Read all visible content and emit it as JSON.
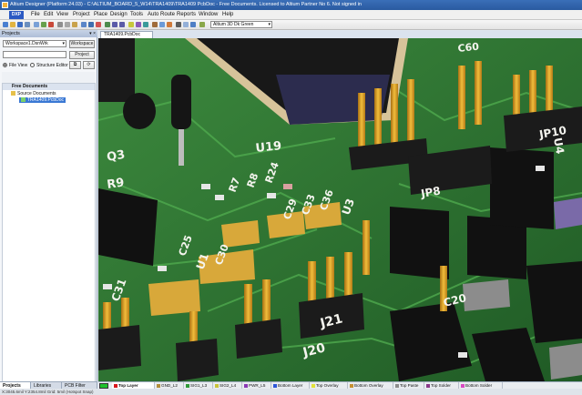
{
  "window": {
    "title": "Altium Designer (Platform 24.03) - C:\\ALTIUM_BOARD_5_W14\\TRA1409\\TRA1409 PcbDoc - Free Documents. Licensed to Altium Partner No 6. Not signed in"
  },
  "menu": {
    "dxp": "DXP",
    "items": [
      "File",
      "Edit",
      "View",
      "Project",
      "Place",
      "Design",
      "Tools",
      "Auto Route",
      "Reports",
      "Window",
      "Help"
    ]
  },
  "toolbar": {
    "view_select": "Altium 3D Dk Green"
  },
  "document": {
    "tab": "TRA1409.PcbDoc"
  },
  "projects_panel": {
    "title": "Projects",
    "workspace_value": "Workspace1.DsnWrk",
    "workspace_button": "Workspace",
    "project_button": "Project",
    "view_options": [
      "File View",
      "Structure Editor"
    ],
    "tree": {
      "root": "Free Documents",
      "folder": "Source Documents",
      "file": "TRA1409.PcbDoc"
    }
  },
  "panel_tabs": [
    "Projects",
    "Libraries",
    "PCB Filter"
  ],
  "layers": [
    {
      "name": "Top Layer",
      "color": "#d9181e"
    },
    {
      "name": "GND_L2",
      "color": "#b38f3c"
    },
    {
      "name": "SIG1_L3",
      "color": "#2f9a3a"
    },
    {
      "name": "SIG2_L4",
      "color": "#c8c23a"
    },
    {
      "name": "PWR_L5",
      "color": "#8b39b5"
    },
    {
      "name": "Bottom Layer",
      "color": "#2e57d8"
    },
    {
      "name": "Top Overlay",
      "color": "#e2e23a"
    },
    {
      "name": "Bottom Overlay",
      "color": "#c69032"
    },
    {
      "name": "Top Paste",
      "color": "#8c8c8c"
    },
    {
      "name": "Top Solder",
      "color": "#8a3a8a"
    },
    {
      "name": "Bottom Solder",
      "color": "#d84ac2"
    }
  ],
  "status": {
    "text": "X:3045.6mil Y:2354.8mil   Grid: 5mil   (Hotspot Snap)"
  },
  "pcb_labels": {
    "designators": [
      "Q3",
      "U19",
      "R9",
      "R7",
      "R8",
      "R24",
      "U3",
      "C60",
      "JP10",
      "JP8",
      "J20",
      "J21",
      "C20",
      "U4",
      "C31",
      "U1",
      "C30",
      "C25",
      "C29",
      "C33",
      "C36"
    ]
  },
  "colors": {
    "board": "#2a6a2e",
    "silkscreen": "#f4f4ee",
    "gold": "#d9a12a",
    "ic_body": "#111111"
  }
}
